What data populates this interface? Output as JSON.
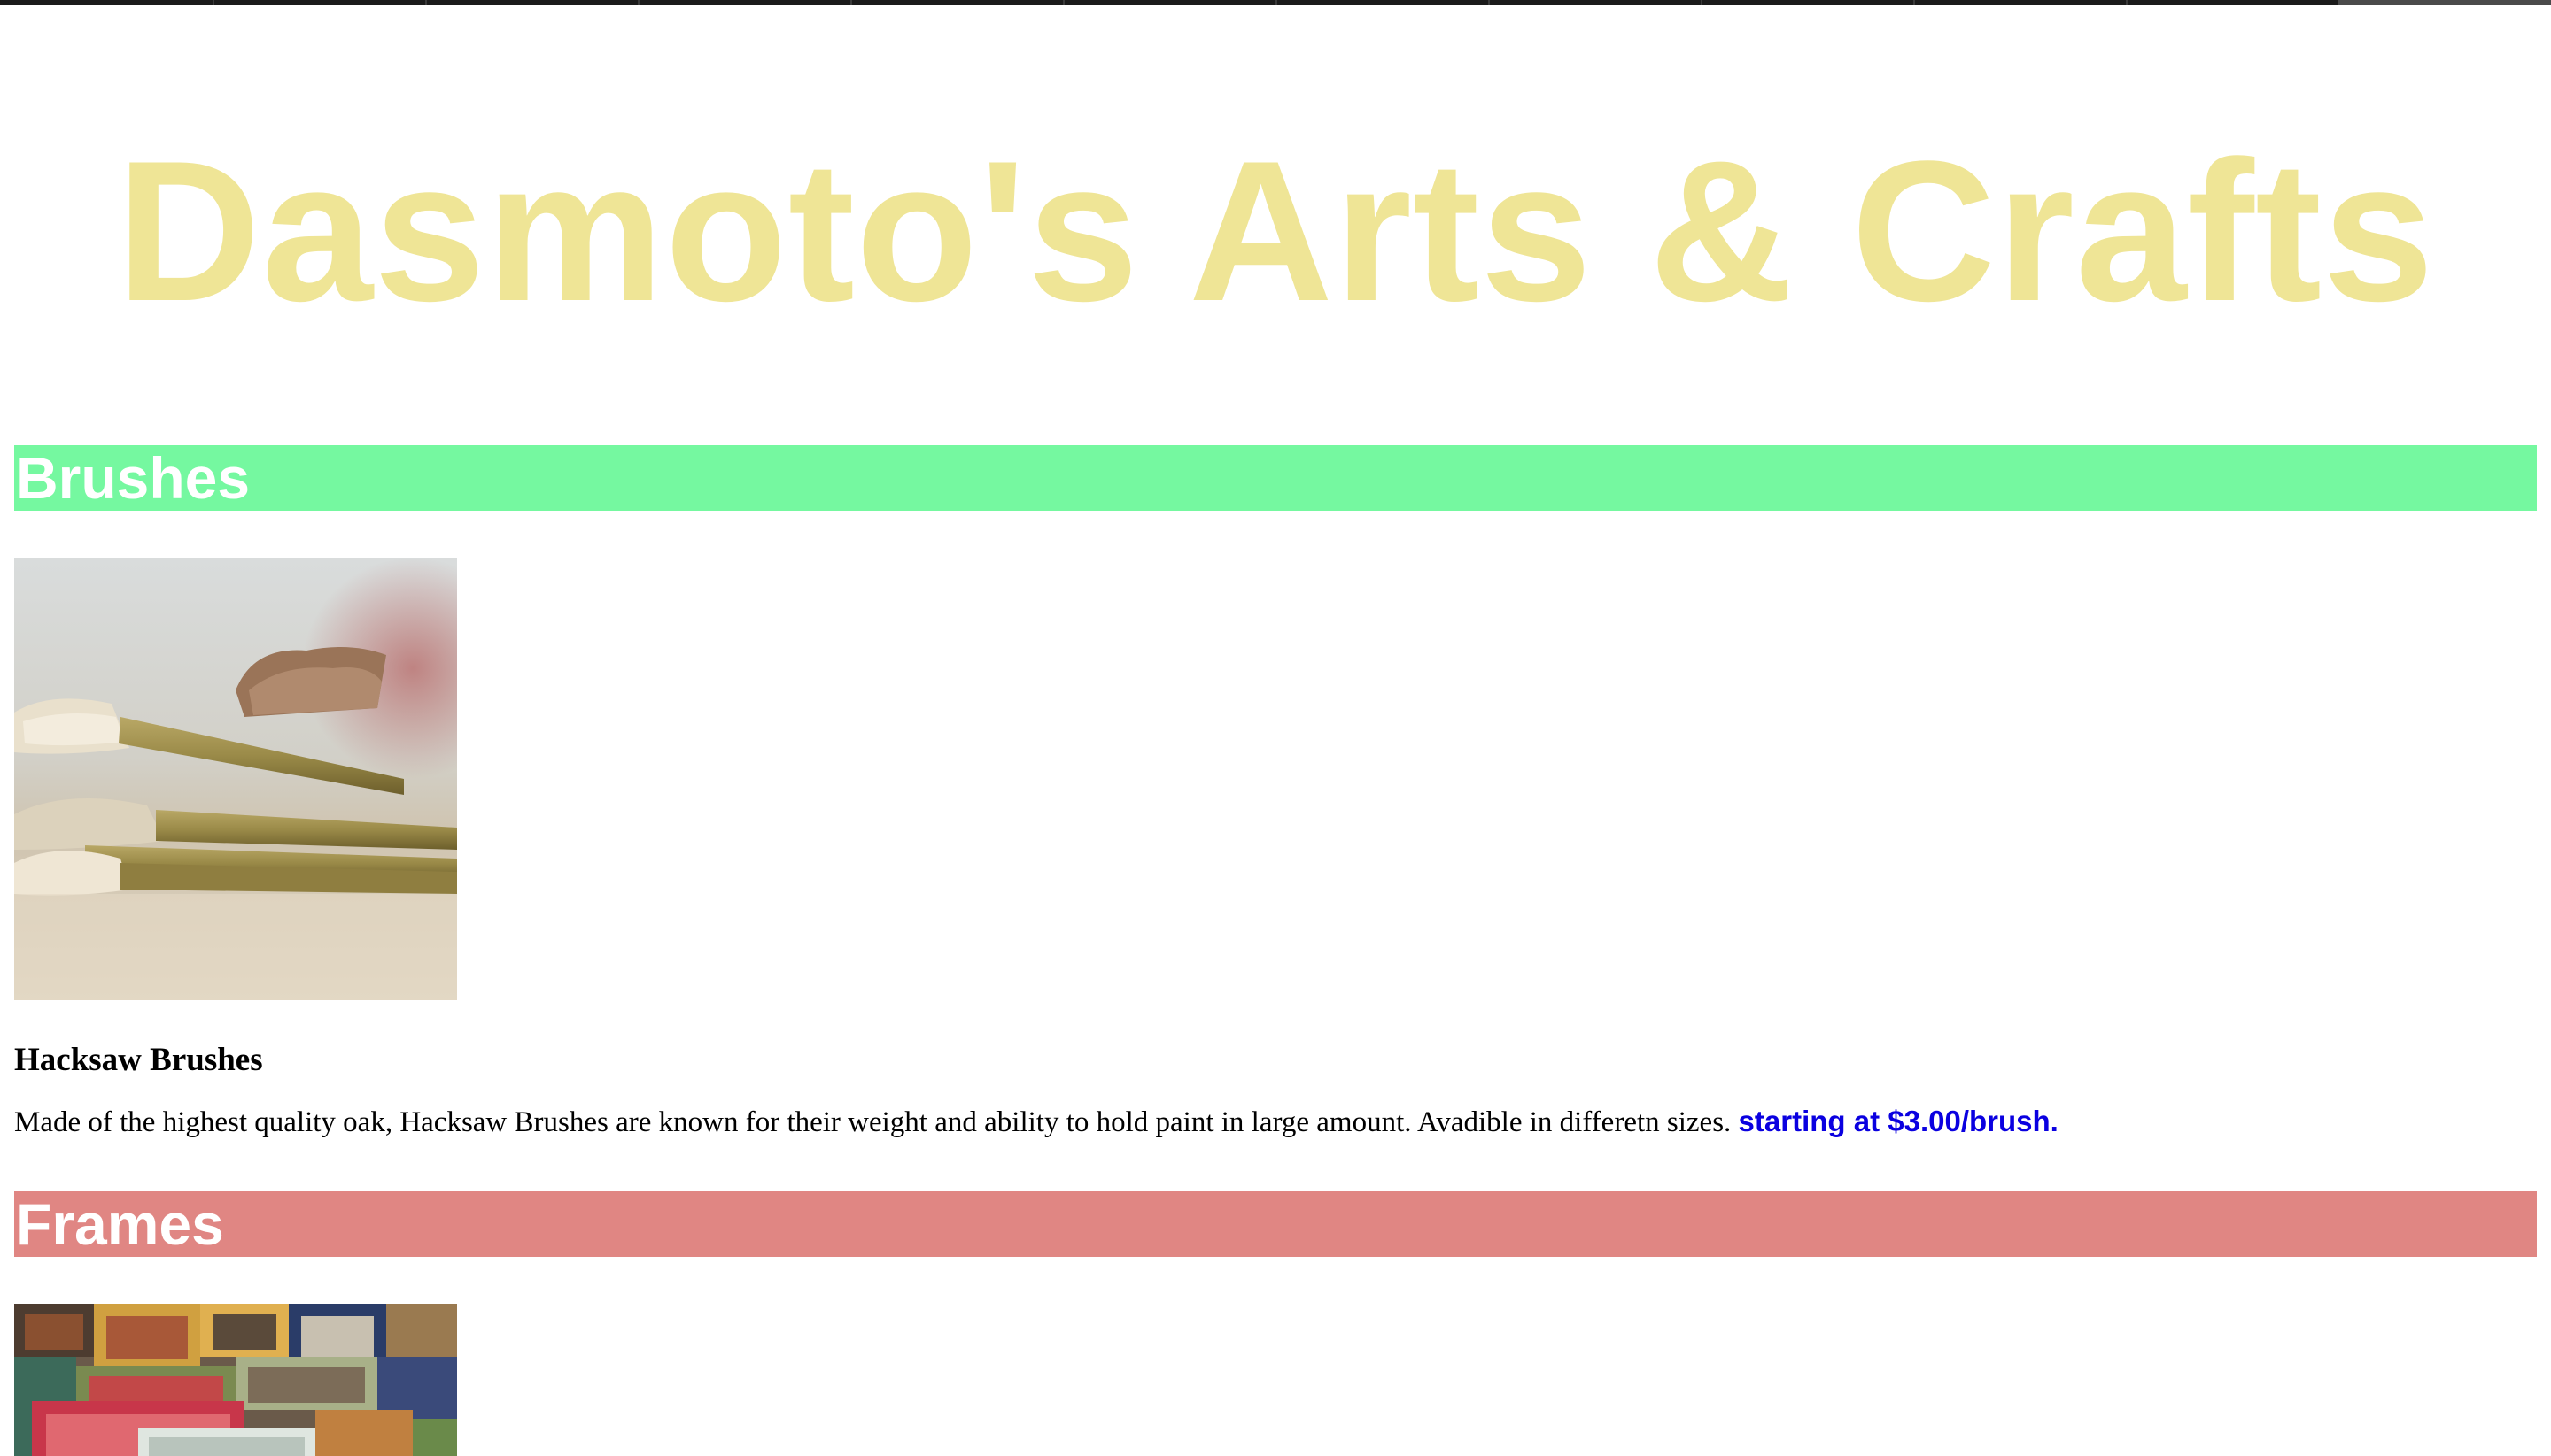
{
  "site": {
    "title": "Dasmoto's Arts & Crafts",
    "title_color": "#efe596"
  },
  "sections": [
    {
      "heading": "Brushes",
      "heading_bg": "#75f8a0",
      "product": {
        "image": "paint-brushes-photo",
        "name": "Hacksaw Brushes",
        "description": "Made of the highest quality oak, Hacksaw Brushes are known for their weight and ability to hold paint in large amount. Avadible in differetn sizes.",
        "price": "starting at $3.00/brush.",
        "price_color": "#0a00e0"
      }
    },
    {
      "heading": "Frames",
      "heading_bg": "#e08683",
      "product": {
        "image": "picture-frames-photo"
      }
    }
  ]
}
